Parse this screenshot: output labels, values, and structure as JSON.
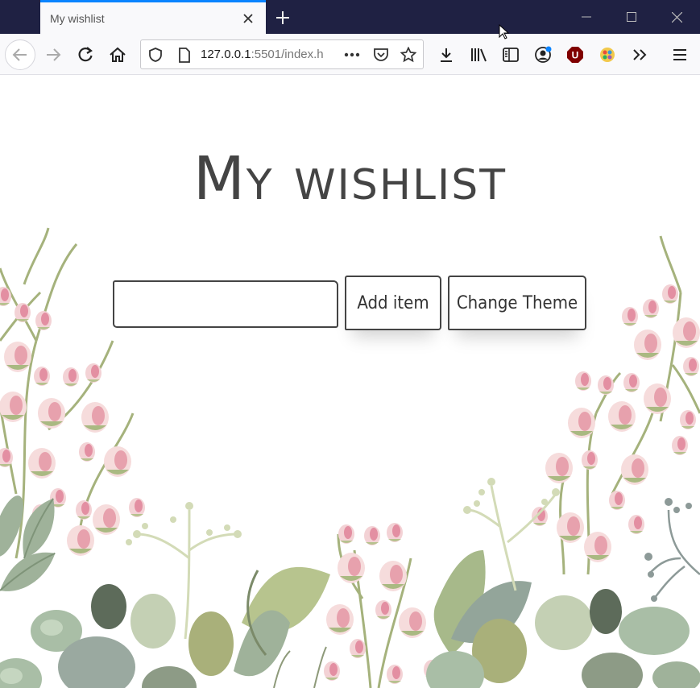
{
  "browser": {
    "tab_title": "My wishlist",
    "url_host": "127.0.0.1",
    "url_rest": ":5501/index.h"
  },
  "page": {
    "heading": "My wishlist",
    "input_value": "",
    "add_button": "Add item",
    "theme_button": "Change Theme"
  },
  "icons": {
    "back": "back-arrow-icon",
    "forward": "forward-arrow-icon",
    "reload": "reload-icon",
    "home": "home-icon",
    "shield": "tracking-shield-icon",
    "page": "page-icon",
    "more": "more-dots-icon",
    "pocket": "pocket-icon",
    "bookmark": "star-icon",
    "download": "download-icon",
    "library": "library-icon",
    "reader": "sidebar-icon",
    "account": "account-icon",
    "ublock": "ublock-icon",
    "extension": "extension-icon",
    "overflow": "overflow-chevron-icon",
    "menu": "hamburger-menu-icon"
  },
  "colors": {
    "titlebar": "#1f2143",
    "tab_accent": "#0a84ff",
    "heading_text": "#444444",
    "flower_pink": "#e8a9b5",
    "leaf_green": "#a7b98a"
  }
}
